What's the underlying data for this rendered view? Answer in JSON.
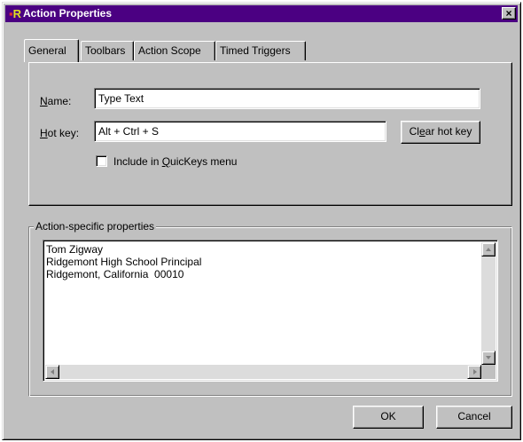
{
  "window": {
    "title": "Action Properties",
    "close_label": "×"
  },
  "tabs": [
    {
      "label": "General",
      "active": true
    },
    {
      "label": "Toolbars",
      "active": false
    },
    {
      "label": "Action Scope",
      "active": false
    },
    {
      "label": "Timed Triggers",
      "active": false
    }
  ],
  "general": {
    "name_label_u": "N",
    "name_label_rest": "ame:",
    "name_value": "Type Text",
    "hotkey_label_u": "H",
    "hotkey_label_rest": "ot key:",
    "hotkey_value": "Alt + Ctrl + S",
    "clear_label_pre": "Cl",
    "clear_label_u": "e",
    "clear_label_post": "ar hot key",
    "include_label_pre": "Include in ",
    "include_label_u": "Q",
    "include_label_post": "uicKeys menu",
    "include_checked": false
  },
  "action_props": {
    "legend": "Action-specific properties",
    "text": "Tom Zigway\nRidgemont High School Principal\nRidgemont, California  00010"
  },
  "footer": {
    "ok_label": "OK",
    "cancel_label": "Cancel"
  },
  "colors": {
    "titlebar": "#4b0082",
    "face": "#c0c0c0"
  }
}
